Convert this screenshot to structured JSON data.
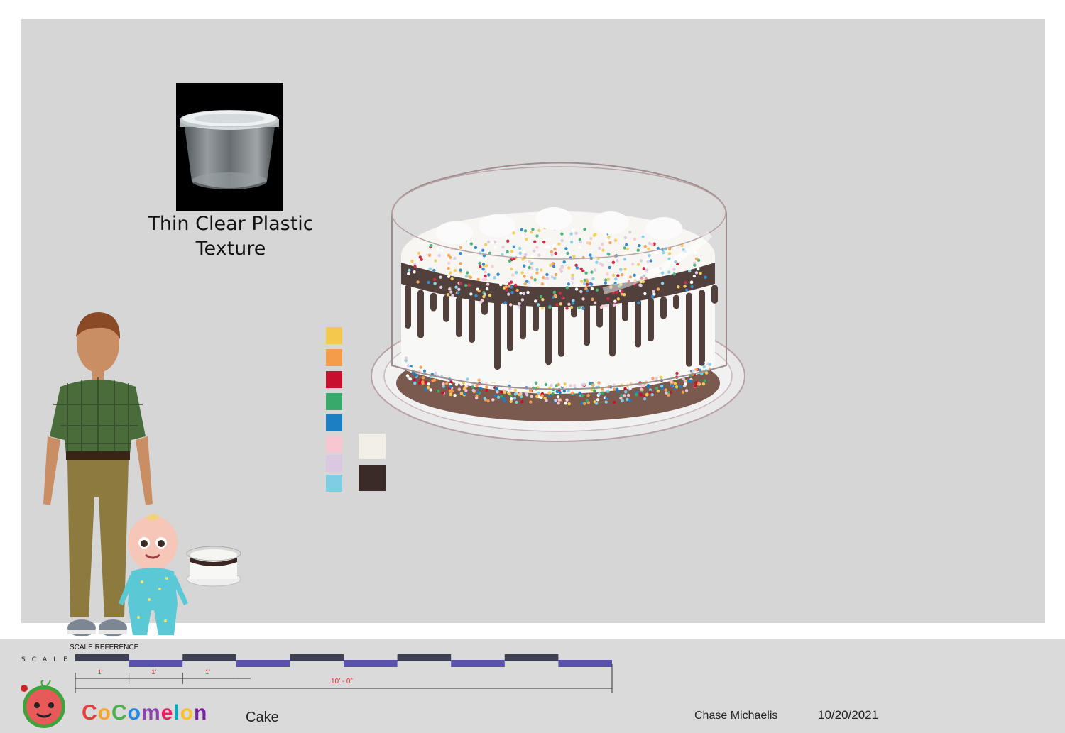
{
  "reference": {
    "label_line1": "Thin Clear Plastic",
    "label_line2": "Texture"
  },
  "palette": [
    "#f2c94c",
    "#f59c4b",
    "#c8102e",
    "#39a96b",
    "#1c7fc4",
    "#f7c6d0",
    "#d9c8e0",
    "#7fcde3"
  ],
  "palette_large": [
    "#f2efe8",
    "#3a2b28"
  ],
  "scale": {
    "word": "SCALE",
    "reference_label": "SCALE REFERENCE",
    "unit_label": "1’",
    "total_label": "10’ - 0”"
  },
  "footer": {
    "brand": "CoComelon",
    "item_name": "Cake",
    "artist": "Chase Michaelis",
    "date": "10/20/2021"
  },
  "icons": {
    "logo": "watermelon-logo-icon"
  },
  "brand_colors": [
    "#e63e3e",
    "#f5a623",
    "#4caf50",
    "#1e88e5",
    "#8e44ad",
    "#e91e63",
    "#00acc1",
    "#fbc02d",
    "#7b1fa2"
  ]
}
